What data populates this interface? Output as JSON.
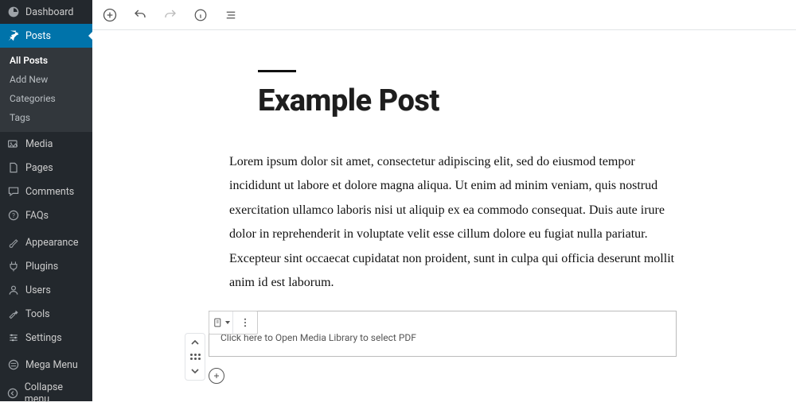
{
  "sidebar": {
    "dashboard": "Dashboard",
    "posts": "Posts",
    "posts_sub": [
      "All Posts",
      "Add New",
      "Categories",
      "Tags"
    ],
    "media": "Media",
    "pages": "Pages",
    "comments": "Comments",
    "faqs": "FAQs",
    "appearance": "Appearance",
    "plugins": "Plugins",
    "users": "Users",
    "tools": "Tools",
    "settings": "Settings",
    "mega_menu": "Mega Menu",
    "collapse": "Collapse menu"
  },
  "post": {
    "title": "Example Post",
    "body": "Lorem ipsum dolor sit amet, consectetur adipiscing elit, sed do eiusmod tempor incididunt ut labore et dolore magna aliqua. Ut enim ad minim veniam, quis nostrud exercitation ullamco laboris nisi ut aliquip ex ea commodo consequat. Duis aute irure dolor in reprehenderit in voluptate velit esse cillum dolore eu fugiat nulla pariatur. Excepteur sint occaecat cupidatat non proident, sunt in culpa qui officia deserunt mollit anim id est laborum."
  },
  "block": {
    "placeholder": "Click here to Open Media Library to select PDF"
  }
}
